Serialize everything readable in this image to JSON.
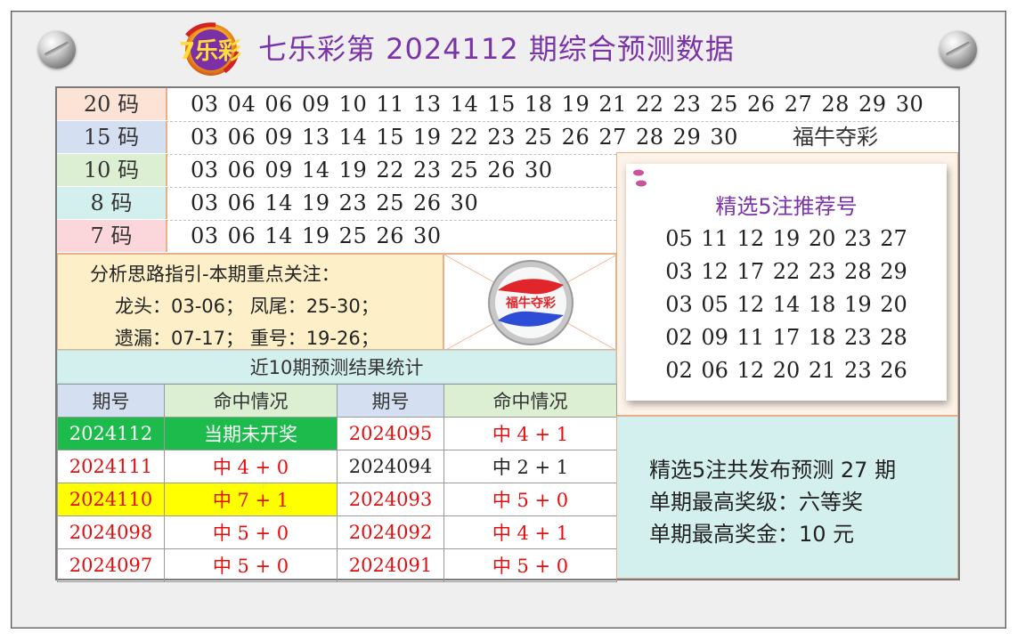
{
  "header": {
    "title": "七乐彩第 2024112 期综合预测数据",
    "logo_text": "7乐彩"
  },
  "colors": {
    "title": "#7a34a8",
    "hit_red": "#e01010",
    "row20": "#fde3d6",
    "row15": "#d4dff2",
    "row10": "#dcefd2",
    "row8": "#d4f0ee",
    "row7": "#fbd7dc",
    "current_green": "#1dbb4c",
    "highlight_yellow": "#ffff00"
  },
  "number_rows": [
    {
      "label": "20 码",
      "numbers": "03 04 06 09 10 11 13 14 15 18 19 21 22 23 25 26 27 28 29 30"
    },
    {
      "label": "15 码",
      "numbers": "03 06 09 13 14 15 19 22 23 25 26 27 28 29 30"
    },
    {
      "label": "10 码",
      "numbers": "03 06 09 14 19 22 23 25 26 30"
    },
    {
      "label": "8 码",
      "numbers": "03 06 14 19 23 25 26 30"
    },
    {
      "label": "7 码",
      "numbers": "03 06 14 19 25 26 30"
    }
  ],
  "slogan": "福牛夺彩",
  "analysis": {
    "heading": "分析思路指引-本期重点关注：",
    "line1": "龙头：03-06； 凤尾：25-30；",
    "line2": "遗漏：07-17； 重号：19-26；"
  },
  "ball_label": "福牛夺彩",
  "recommend": {
    "title": "精选5注推荐号",
    "lines": [
      "05 11 12 19 20 23 27",
      "03 12 17 22 23 28 29",
      "03 05 12 14 18 19 20",
      "02 09 11 17 18 23 28",
      "02 06 12 20 21 23 26"
    ]
  },
  "stats": {
    "title": "近10期预测结果统计",
    "headers": [
      "期号",
      "命中情况",
      "期号",
      "命中情况"
    ],
    "rows": [
      {
        "p1": "2024112",
        "h1": "当期未开奖",
        "p2": "2024095",
        "h2": "中 4 + 1"
      },
      {
        "p1": "2024111",
        "h1": "中 4 + 0",
        "p2": "2024094",
        "h2": "中 2 + 1"
      },
      {
        "p1": "2024110",
        "h1": "中 7 + 1",
        "p2": "2024093",
        "h2": "中 5 + 0"
      },
      {
        "p1": "2024098",
        "h1": "中 5 + 0",
        "p2": "2024092",
        "h2": "中 4 + 1"
      },
      {
        "p1": "2024097",
        "h1": "中 5 + 0",
        "p2": "2024091",
        "h2": "中 5 + 0"
      }
    ]
  },
  "summary": {
    "line1": "精选5注共发布预测 27 期",
    "line2": "单期最高奖级：六等奖",
    "line3": "单期最高奖金：10 元"
  }
}
